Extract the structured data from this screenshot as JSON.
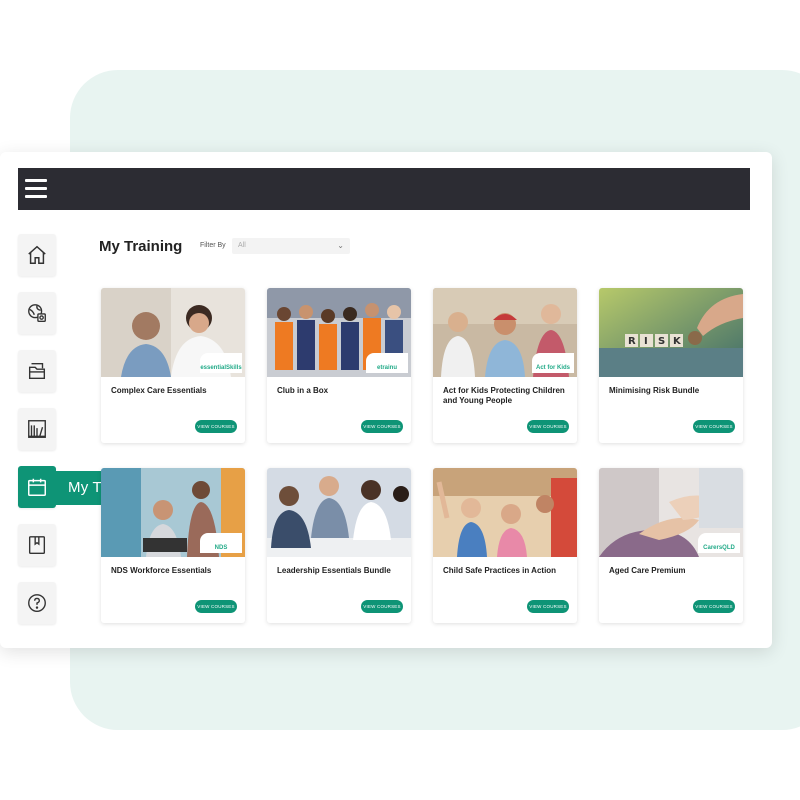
{
  "header": {
    "menu_icon": "hamburger-menu-icon"
  },
  "sidebar": {
    "items": [
      {
        "icon": "home-icon"
      },
      {
        "icon": "globe-certificate-icon"
      },
      {
        "icon": "folder-tray-icon"
      },
      {
        "icon": "library-books-icon"
      },
      {
        "icon": "calendar-icon",
        "label": "My Training",
        "active": true
      },
      {
        "icon": "bookmark-book-icon"
      },
      {
        "icon": "help-question-icon"
      }
    ]
  },
  "main": {
    "title": "My Training",
    "filter_label": "Filter By",
    "filter_value": "All"
  },
  "cards": [
    {
      "title": "Complex Care Essentials",
      "button": "VIEW COURSES",
      "badge": "essentialSkills"
    },
    {
      "title": "Club in a Box",
      "button": "VIEW COURSES",
      "badge": "etrainu"
    },
    {
      "title": "Act for Kids Protecting Children and Young People",
      "button": "VIEW COURSES",
      "badge": "Act for Kids"
    },
    {
      "title": "Minimising Risk Bundle",
      "button": "VIEW COURSES",
      "badge": ""
    },
    {
      "title": "NDS Workforce Essentials",
      "button": "VIEW COURSES",
      "badge": "NDS"
    },
    {
      "title": "Leadership Essentials Bundle",
      "button": "VIEW COURSES",
      "badge": ""
    },
    {
      "title": "Child Safe Practices in Action",
      "button": "VIEW COURSES",
      "badge": ""
    },
    {
      "title": "Aged Care Premium",
      "button": "VIEW COURSES",
      "badge": "CarersQLD"
    }
  ],
  "colors": {
    "accent": "#0e9476",
    "topbar": "#2c2c33",
    "background_shape": "#e8f4f1"
  }
}
